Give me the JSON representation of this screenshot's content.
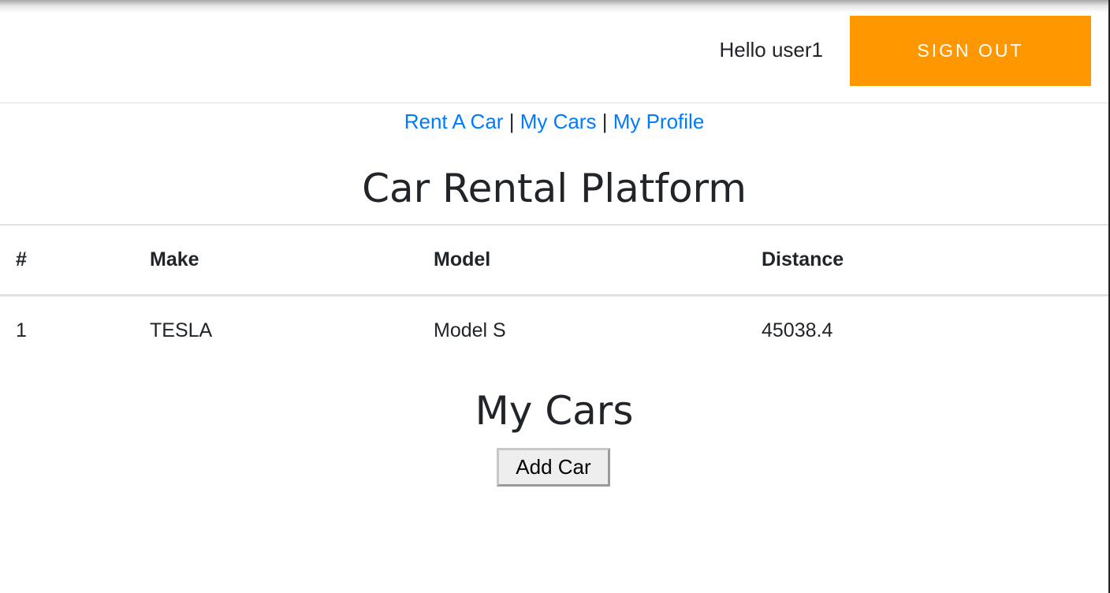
{
  "header": {
    "greeting": "Hello user1",
    "signout_label": "SIGN OUT",
    "accent_color": "#ff9800"
  },
  "nav": {
    "links": [
      {
        "label": "Rent A Car"
      },
      {
        "label": "My Cars"
      },
      {
        "label": "My Profile"
      }
    ],
    "separator": "|",
    "link_color": "#007bff"
  },
  "main": {
    "title": "Car Rental Platform",
    "table": {
      "headers": [
        "#",
        "Make",
        "Model",
        "Distance"
      ],
      "rows": [
        [
          "1",
          "TESLA",
          "Model S",
          "45038.4"
        ]
      ]
    },
    "section_title": "My Cars",
    "add_button_label": "Add Car"
  }
}
